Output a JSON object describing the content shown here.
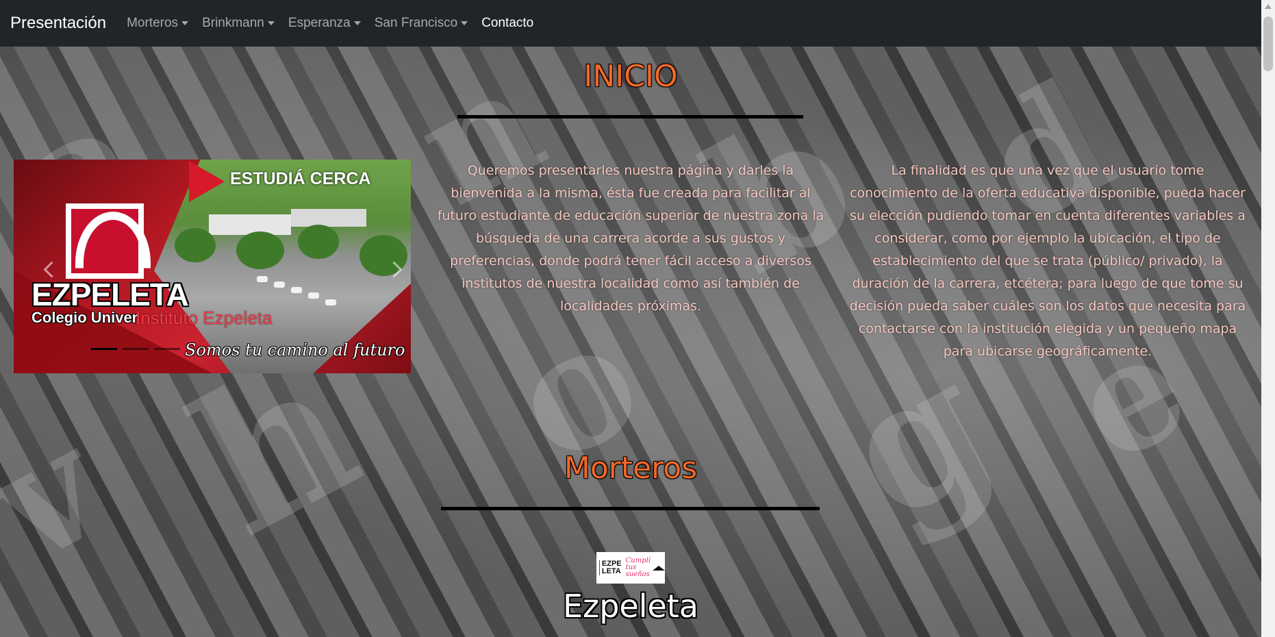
{
  "navbar": {
    "brand": "Presentación",
    "items": [
      {
        "label": "Morteros",
        "dropdown": true
      },
      {
        "label": "Brinkmann",
        "dropdown": true
      },
      {
        "label": "Esperanza",
        "dropdown": true
      },
      {
        "label": "San Francisco",
        "dropdown": true
      },
      {
        "label": "Contacto",
        "dropdown": false
      }
    ]
  },
  "inicio": {
    "title": "INICIO",
    "paragraph_left": "Queremos presentarles nuestra página y darles la bienvenida a la misma, ésta fue creada para facilitar al futuro estudiante de educación superior de nuestra zona la búsqueda de una carrera acorde a sus gustos y preferencias, donde podrá tener fácil acceso a diversos institutos de nuestra localidad como así también de localidades próximas.",
    "paragraph_right": "La finalidad es que una vez que el usuario tome conocimiento de la oferta educativa disponible, pueda hacer su elección pudiendo tomar en cuenta diferentes variables a considerar, como por ejemplo la ubicación, el tipo de establecimiento del que se trata (público/ privado), la duración de la carrera, etcétera; para luego de que tome su decisión pueda saber cuáles son los datos que necesita para contactarse con la institución elegida y un pequeño mapa para ubicarse geográficamente."
  },
  "carousel": {
    "banner_text": "ESTUDIÁ CERCA",
    "logo_name": "EZPELETA",
    "logo_subtitle": "Colegio Univer",
    "caption": "Instituto Ezpeleta",
    "slogan": "Somos tu camino al futuro",
    "active_index": 0,
    "slide_count": 3
  },
  "morteros": {
    "title": "Morteros",
    "institution": {
      "logo_text_top": "EZPE",
      "logo_text_bottom": "LETA",
      "logo_script_top": "Cumplí",
      "logo_script_bottom": "tus sueños",
      "name": "Ezpeleta"
    }
  },
  "colors": {
    "navbar_bg": "#212529",
    "heading": "#f2682a",
    "paragraph": "#f7c8c0",
    "brand_red": "#c8102e"
  }
}
